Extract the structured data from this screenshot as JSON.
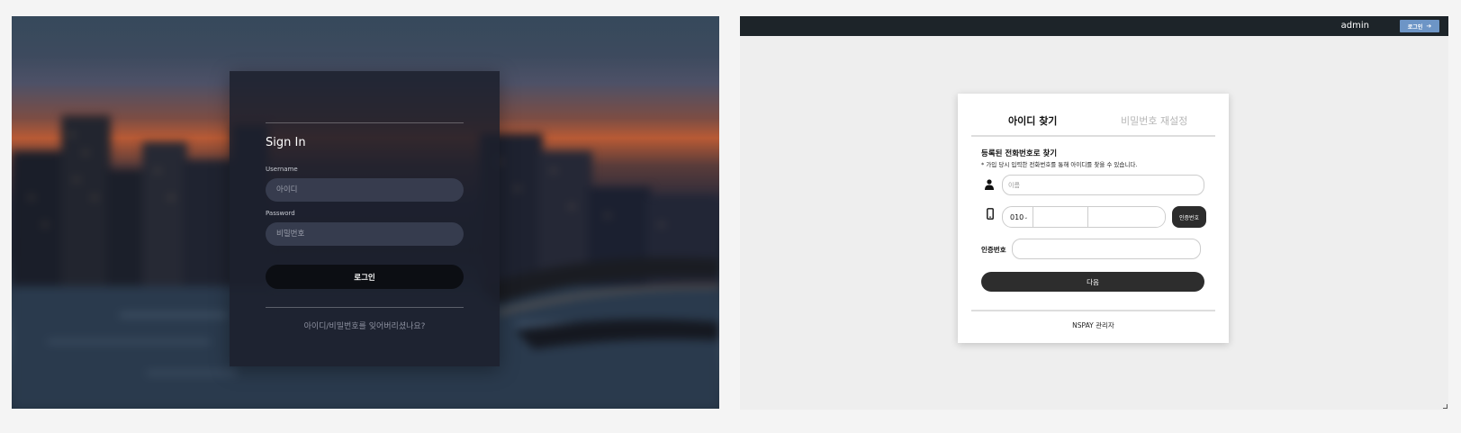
{
  "left": {
    "title": "Sign In",
    "username_label": "Username",
    "username_placeholder": "아이디",
    "password_label": "Password",
    "password_placeholder": "비밀번호",
    "login_button": "로그인",
    "forgot_link": "아이디/비밀번호를 잊어버리셨나요?"
  },
  "right": {
    "topbar": {
      "user": "admin",
      "login_button": "로그인",
      "login_icon": "arrow-right-icon"
    },
    "tabs": [
      {
        "label": "아이디 찾기",
        "active": true
      },
      {
        "label": "비밀번호 재설정",
        "active": false
      }
    ],
    "section_title": "등록된 전화번호로 찾기",
    "section_note": "* 가입 당시 입력한 전화번호를 통해 아이디를 찾을 수 있습니다.",
    "name_icon": "person-icon",
    "name_placeholder": "이름",
    "phone_icon": "mobile-phone-icon",
    "phone_prefix": "010",
    "auth_button": "인증번호",
    "code_label": "인증번호",
    "next_button": "다음",
    "footer": "NSPAY 관리자"
  }
}
